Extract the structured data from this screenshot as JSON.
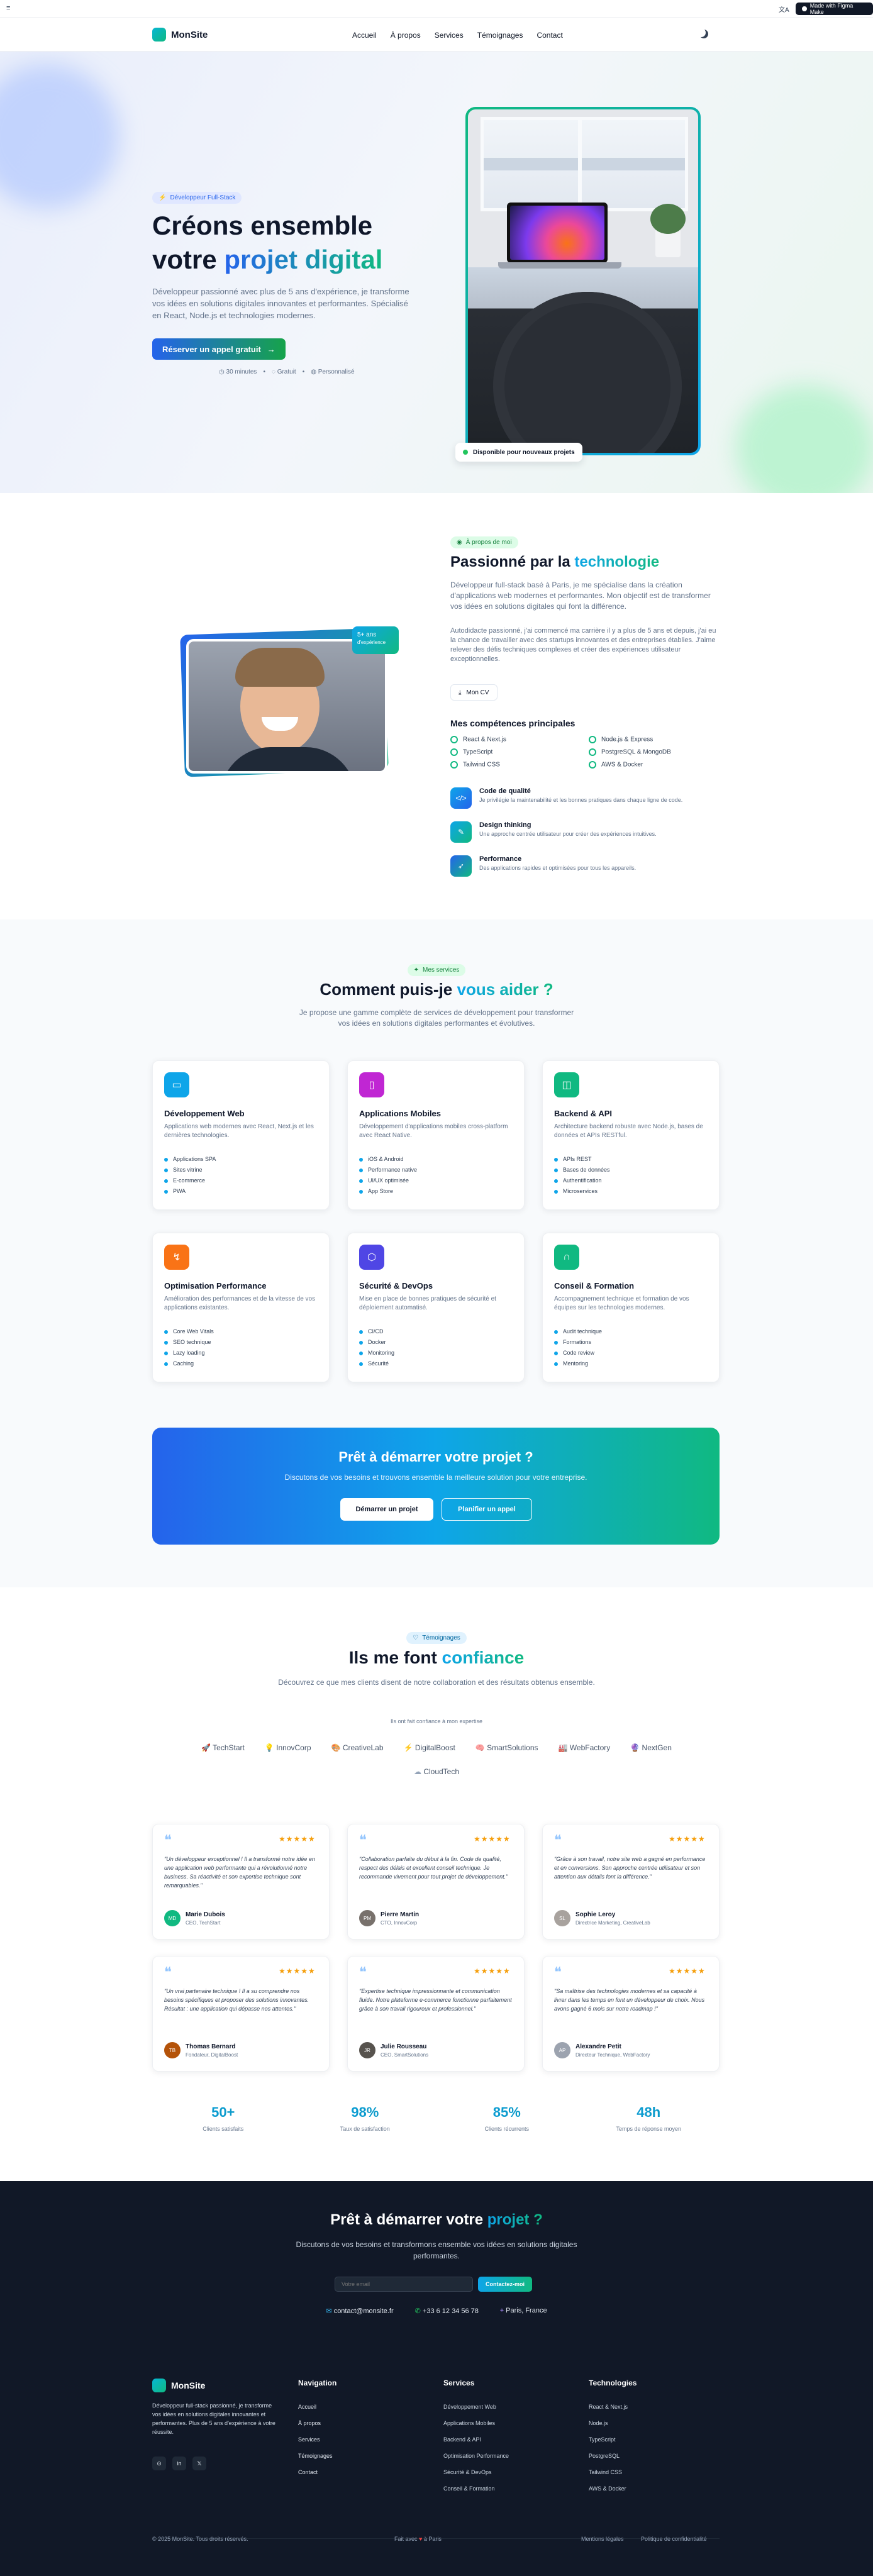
{
  "browser": {
    "page_icon": "≡",
    "translate_label": "文A",
    "made_with": "Made with Figma Make"
  },
  "nav": {
    "brand": "MonSite",
    "links": [
      "Accueil",
      "À propos",
      "Services",
      "Témoignages",
      "Contact"
    ],
    "theme_icon": "moon-icon"
  },
  "hero": {
    "badge": "Développeur Full-Stack",
    "title_line1": "Créons ensemble",
    "title_line2_plain": "votre ",
    "title_line2_accent": "projet digital",
    "description": "Développeur passionné avec plus de 5 ans d'expérience, je transforme vos idées en solutions digitales innovantes et performantes. Spécialisé en React, Node.js et technologies modernes.",
    "cta": "Réserver un appel gratuit",
    "meta": [
      "30 minutes",
      "Gratuit",
      "Personnalisé"
    ],
    "availability": "Disponible pour nouveaux projets"
  },
  "about": {
    "badge": "À propos de moi",
    "experience_badge_line1": "5+ ans",
    "experience_badge_line2": "d'expérience",
    "title_plain": "Passionné par la ",
    "title_accent": "technologie",
    "p1": "Développeur full-stack basé à Paris, je me spécialise dans la création d'applications web modernes et performantes. Mon objectif est de transformer vos idées en solutions digitales qui font la différence.",
    "p2": "Autodidacte passionné, j'ai commencé ma carrière il y a plus de 5 ans et depuis, j'ai eu la chance de travailler avec des startups innovantes et des entreprises établies. J'aime relever des défis techniques complexes et créer des expériences utilisateur exceptionnelles.",
    "cv_button": "Mon CV",
    "skills_title": "Mes compétences principales",
    "skills": [
      "React & Next.js",
      "Node.js & Express",
      "TypeScript",
      "PostgreSQL & MongoDB",
      "Tailwind CSS",
      "AWS & Docker"
    ],
    "features": [
      {
        "title": "Code de qualité",
        "desc": "Je privilégie la maintenabilité et les bonnes pratiques dans chaque ligne de code."
      },
      {
        "title": "Design thinking",
        "desc": "Une approche centrée utilisateur pour créer des expériences intuitives."
      },
      {
        "title": "Performance",
        "desc": "Des applications rapides et optimisées pour tous les appareils."
      }
    ]
  },
  "services": {
    "badge": "Mes services",
    "title_plain": "Comment puis-je ",
    "title_accent": "vous aider ?",
    "subtitle": "Je propose une gamme complète de services de développement pour transformer vos idées en solutions digitales performantes et évolutives.",
    "items": [
      {
        "title": "Développement Web",
        "desc": "Applications web modernes avec React, Next.js et les dernières technologies.",
        "points": [
          "Applications SPA",
          "Sites vitrine",
          "E-commerce",
          "PWA"
        ],
        "color": "#0ea5e9"
      },
      {
        "title": "Applications Mobiles",
        "desc": "Développement d'applications mobiles cross-platform avec React Native.",
        "points": [
          "iOS & Android",
          "Performance native",
          "UI/UX optimisée",
          "App Store"
        ],
        "color": "#c026d3"
      },
      {
        "title": "Backend & API",
        "desc": "Architecture backend robuste avec Node.js, bases de données et APIs RESTful.",
        "points": [
          "APIs REST",
          "Bases de données",
          "Authentification",
          "Microservices"
        ],
        "color": "#10b981"
      },
      {
        "title": "Optimisation Performance",
        "desc": "Amélioration des performances et de la vitesse de vos applications existantes.",
        "points": [
          "Core Web Vitals",
          "SEO technique",
          "Lazy loading",
          "Caching"
        ],
        "color": "#f97316"
      },
      {
        "title": "Sécurité & DevOps",
        "desc": "Mise en place de bonnes pratiques de sécurité et déploiement automatisé.",
        "points": [
          "CI/CD",
          "Docker",
          "Monitoring",
          "Sécurité"
        ],
        "color": "#4f46e5"
      },
      {
        "title": "Conseil & Formation",
        "desc": "Accompagnement technique et formation de vos équipes sur les technologies modernes.",
        "points": [
          "Audit technique",
          "Formations",
          "Code review",
          "Mentoring"
        ],
        "color": "#10b981"
      }
    ],
    "cta_title": "Prêt à démarrer votre projet ?",
    "cta_text": "Discutons de vos besoins et trouvons ensemble la meilleure solution pour votre entreprise.",
    "cta_btn1": "Démarrer un projet",
    "cta_btn2": "Planifier un appel"
  },
  "testimonials": {
    "badge": "Témoignages",
    "title_plain": "Ils me font ",
    "title_accent": "confiance",
    "subtitle": "Découvrez ce que mes clients disent de notre collaboration et des résultats obtenus ensemble.",
    "trust_label": "Ils ont fait confiance à mon expertise",
    "logos": [
      "TechStart",
      "InnovCorp",
      "CreativeLab",
      "DigitalBoost",
      "SmartSolutions",
      "WebFactory",
      "NextGen",
      "CloudTech"
    ],
    "items": [
      {
        "quote": "\"Un développeur exceptionnel ! Il a transformé notre idée en une application web performante qui a révolutionné notre business. Sa réactivité et son expertise technique sont remarquables.\"",
        "name": "Marie Dubois",
        "role": "CEO, TechStart",
        "initials": "MD"
      },
      {
        "quote": "\"Collaboration parfaite du début à la fin. Code de qualité, respect des délais et excellent conseil technique. Je recommande vivement pour tout projet de développement.\"",
        "name": "Pierre Martin",
        "role": "CTO, InnovCorp",
        "initials": "PM"
      },
      {
        "quote": "\"Grâce à son travail, notre site web a gagné en performance et en conversions. Son approche centrée utilisateur et son attention aux détails font la différence.\"",
        "name": "Sophie Leroy",
        "role": "Directrice Marketing, CreativeLab",
        "initials": "SL"
      },
      {
        "quote": "\"Un vrai partenaire technique ! Il a su comprendre nos besoins spécifiques et proposer des solutions innovantes. Résultat : une application qui dépasse nos attentes.\"",
        "name": "Thomas Bernard",
        "role": "Fondateur, DigitalBoost",
        "initials": "TB"
      },
      {
        "quote": "\"Expertise technique impressionnante et communication fluide. Notre plateforme e-commerce fonctionne parfaitement grâce à son travail rigoureux et professionnel.\"",
        "name": "Julie Rousseau",
        "role": "CEO, SmartSolutions",
        "initials": "JR"
      },
      {
        "quote": "\"Sa maîtrise des technologies modernes et sa capacité à livrer dans les temps en font un développeur de choix. Nous avons gagné 6 mois sur notre roadmap !\"",
        "name": "Alexandre Petit",
        "role": "Directeur Technique, WebFactory",
        "initials": "AP"
      }
    ],
    "stats": [
      {
        "value": "50+",
        "label": "Clients satisfaits"
      },
      {
        "value": "98%",
        "label": "Taux de satisfaction"
      },
      {
        "value": "85%",
        "label": "Clients récurrents"
      },
      {
        "value": "48h",
        "label": "Temps de réponse moyen"
      }
    ]
  },
  "contact": {
    "title_plain": "Prêt à démarrer votre ",
    "title_accent": "projet ?",
    "subtitle": "Discutons de vos besoins et transformons ensemble vos idées en solutions digitales performantes.",
    "email_placeholder": "Votre email",
    "button": "Contactez-moi",
    "email": "contact@monsite.fr",
    "phone": "+33 6 12 34 56 78",
    "city": "Paris, France"
  },
  "footer": {
    "brand": "MonSite",
    "about": "Développeur full-stack passionné, je transforme vos idées en solutions digitales innovantes et performantes. Plus de 5 ans d'expérience à votre réussite.",
    "col1_title": "Navigation",
    "col1": [
      "Accueil",
      "À propos",
      "Services",
      "Témoignages",
      "Contact"
    ],
    "col2_title": "Services",
    "col2": [
      "Développement Web",
      "Applications Mobiles",
      "Backend & API",
      "Optimisation Performance",
      "Sécurité & DevOps",
      "Conseil & Formation"
    ],
    "col3_title": "Technologies",
    "col3": [
      "React & Next.js",
      "Node.js",
      "TypeScript",
      "PostgreSQL",
      "Tailwind CSS",
      "AWS & Docker"
    ],
    "copyright": "© 2025 MonSite. Tous droits réservés.",
    "made_pre": "Fait avec",
    "made_post": "à Paris",
    "legal1": "Mentions légales",
    "legal2": "Politique de confidentialité"
  }
}
